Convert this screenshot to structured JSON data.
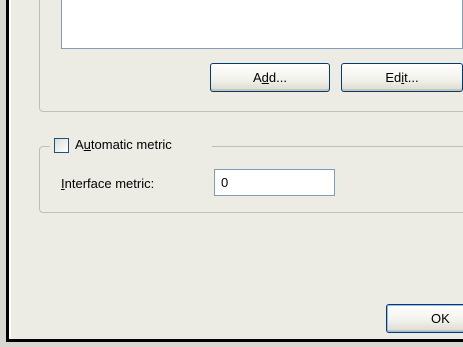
{
  "gateway_group": {
    "add_label_pre": "A",
    "add_label_ul": "d",
    "add_label_post": "d...",
    "edit_label_pre": "Ed",
    "edit_label_ul": "i",
    "edit_label_post": "t..."
  },
  "metric_group": {
    "checkbox_label_pre": "A",
    "checkbox_label_ul": "u",
    "checkbox_label_post": "tomatic metric",
    "checkbox_checked": false,
    "metric_label_ul": "I",
    "metric_label_post": "nterface metric:",
    "metric_value": "0"
  },
  "footer": {
    "ok_label": "OK"
  }
}
